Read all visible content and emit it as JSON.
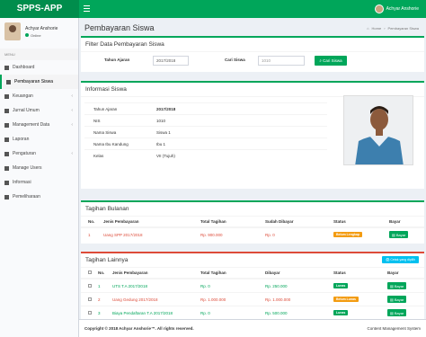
{
  "app": {
    "logo": "SPPS-APP",
    "user": "Achyar Anshorie"
  },
  "sidebar": {
    "user_name": "Achyar Anshorie",
    "status": "Online",
    "menu_header": "MENU",
    "items": [
      {
        "label": "Dashboard",
        "icon": "dashboard-icon"
      },
      {
        "label": "Pembayaran Siswa",
        "icon": "money-icon"
      },
      {
        "label": "Keuangan",
        "icon": "wallet-icon"
      },
      {
        "label": "Jurnal Umum",
        "icon": "book-icon"
      },
      {
        "label": "Management Data",
        "icon": "database-icon"
      },
      {
        "label": "Laporan",
        "icon": "report-icon"
      },
      {
        "label": "Pengaturan",
        "icon": "gear-icon"
      },
      {
        "label": "Manage Users",
        "icon": "users-icon"
      },
      {
        "label": "Informasi",
        "icon": "info-icon"
      },
      {
        "label": "Pemeliharaan",
        "icon": "wrench-icon"
      }
    ]
  },
  "page": {
    "title": "Pembayaran Siswa",
    "breadcrumb_home": "Home",
    "breadcrumb_current": "Pembayaran Siswa"
  },
  "filter": {
    "title": "Filter Data Pembayaran Siswa",
    "year_label": "Tahun Ajaran",
    "year_value": "2017/2018",
    "search_label": "Cari Siswa",
    "search_value": "1010",
    "search_button": "Cari Siswa"
  },
  "info": {
    "title": "Informasi Siswa",
    "rows": [
      {
        "k": "Tahun Ajaran",
        "v": "2017/2018"
      },
      {
        "k": "NIS",
        "v": "1010"
      },
      {
        "k": "Nama Siswa",
        "v": "Siswa 1"
      },
      {
        "k": "Nama Ibu Kandung",
        "v": "Ibu 1"
      },
      {
        "k": "Kelas",
        "v": "VII (Tujuh)"
      }
    ]
  },
  "monthly": {
    "title": "Tagihan Bulanan",
    "headers": [
      "No.",
      "Jenis Pembayaran",
      "Total Tagihan",
      "Sudah Dibayar",
      "Status",
      "Bayar"
    ],
    "rows": [
      {
        "no": "1",
        "jenis": "Uang SPP 2017/2018",
        "total": "Rp. 900.000",
        "dibayar": "Rp. 0",
        "status": "Belum Lengkap",
        "bayar": "Bayar"
      }
    ]
  },
  "other": {
    "title": "Tagihan Lainnya",
    "print_button": "Cetak yang dipilih",
    "headers": [
      "No.",
      "Jenis Pembayaran",
      "Total Tagihan",
      "Dibayar",
      "Status",
      "Bayar"
    ],
    "rows": [
      {
        "no": "1",
        "jenis": "UTS T.A 2017/2018",
        "total": "Rp. 0",
        "dibayar": "Rp. 250.000",
        "status": "Lunas",
        "bayar": "Bayar"
      },
      {
        "no": "2",
        "jenis": "Uang Gedung 2017/2018",
        "total": "Rp. 1.000.000",
        "dibayar": "Rp. 1.000.000",
        "status": "Belum Lunas",
        "bayar": "Bayar"
      },
      {
        "no": "3",
        "jenis": "Biaya Pendaftaran T.A 2017/2018",
        "total": "Rp. 0",
        "dibayar": "Rp. 500.000",
        "status": "Lunas",
        "bayar": "Bayar"
      }
    ]
  },
  "footer": {
    "copyright": "Copyright © 2018 Achyar Anshorie™. All rights reserved.",
    "right": "Content Management System"
  }
}
